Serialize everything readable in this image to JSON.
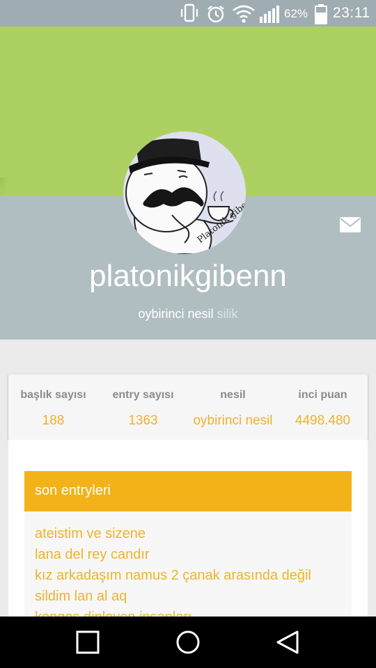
{
  "status_bar": {
    "battery_text": "62%",
    "time": "23:11",
    "icons": [
      "vibrate-icon",
      "alarm-icon",
      "wifi-icon",
      "signal-icon",
      "battery-icon"
    ]
  },
  "profile": {
    "username": "platonikgibenn",
    "generation": "oybirinci nesil",
    "status_tag": "silik",
    "avatar_caption": "Platonik giben"
  },
  "stats": [
    {
      "label": "başlık sayısı",
      "value": "188"
    },
    {
      "label": "entry sayısı",
      "value": "1363"
    },
    {
      "label": "nesil",
      "value": "oybirinci nesil"
    },
    {
      "label": "inci puan",
      "value": "4498.480"
    }
  ],
  "recent": {
    "title": "son entryleri",
    "entries": [
      "ateistim ve sizene",
      "lana del rey candır",
      "kız arkadaşım namus 2 çanak arasında değil",
      "sildim lan al aq",
      "kongos dinleyen insanları"
    ]
  },
  "colors": {
    "cover": "#acd162",
    "profile_band": "#b0bec2",
    "accent": "#f2b218",
    "status_bar": "#9fadb2"
  },
  "nav": [
    "recent-apps-icon",
    "home-icon",
    "back-icon"
  ]
}
